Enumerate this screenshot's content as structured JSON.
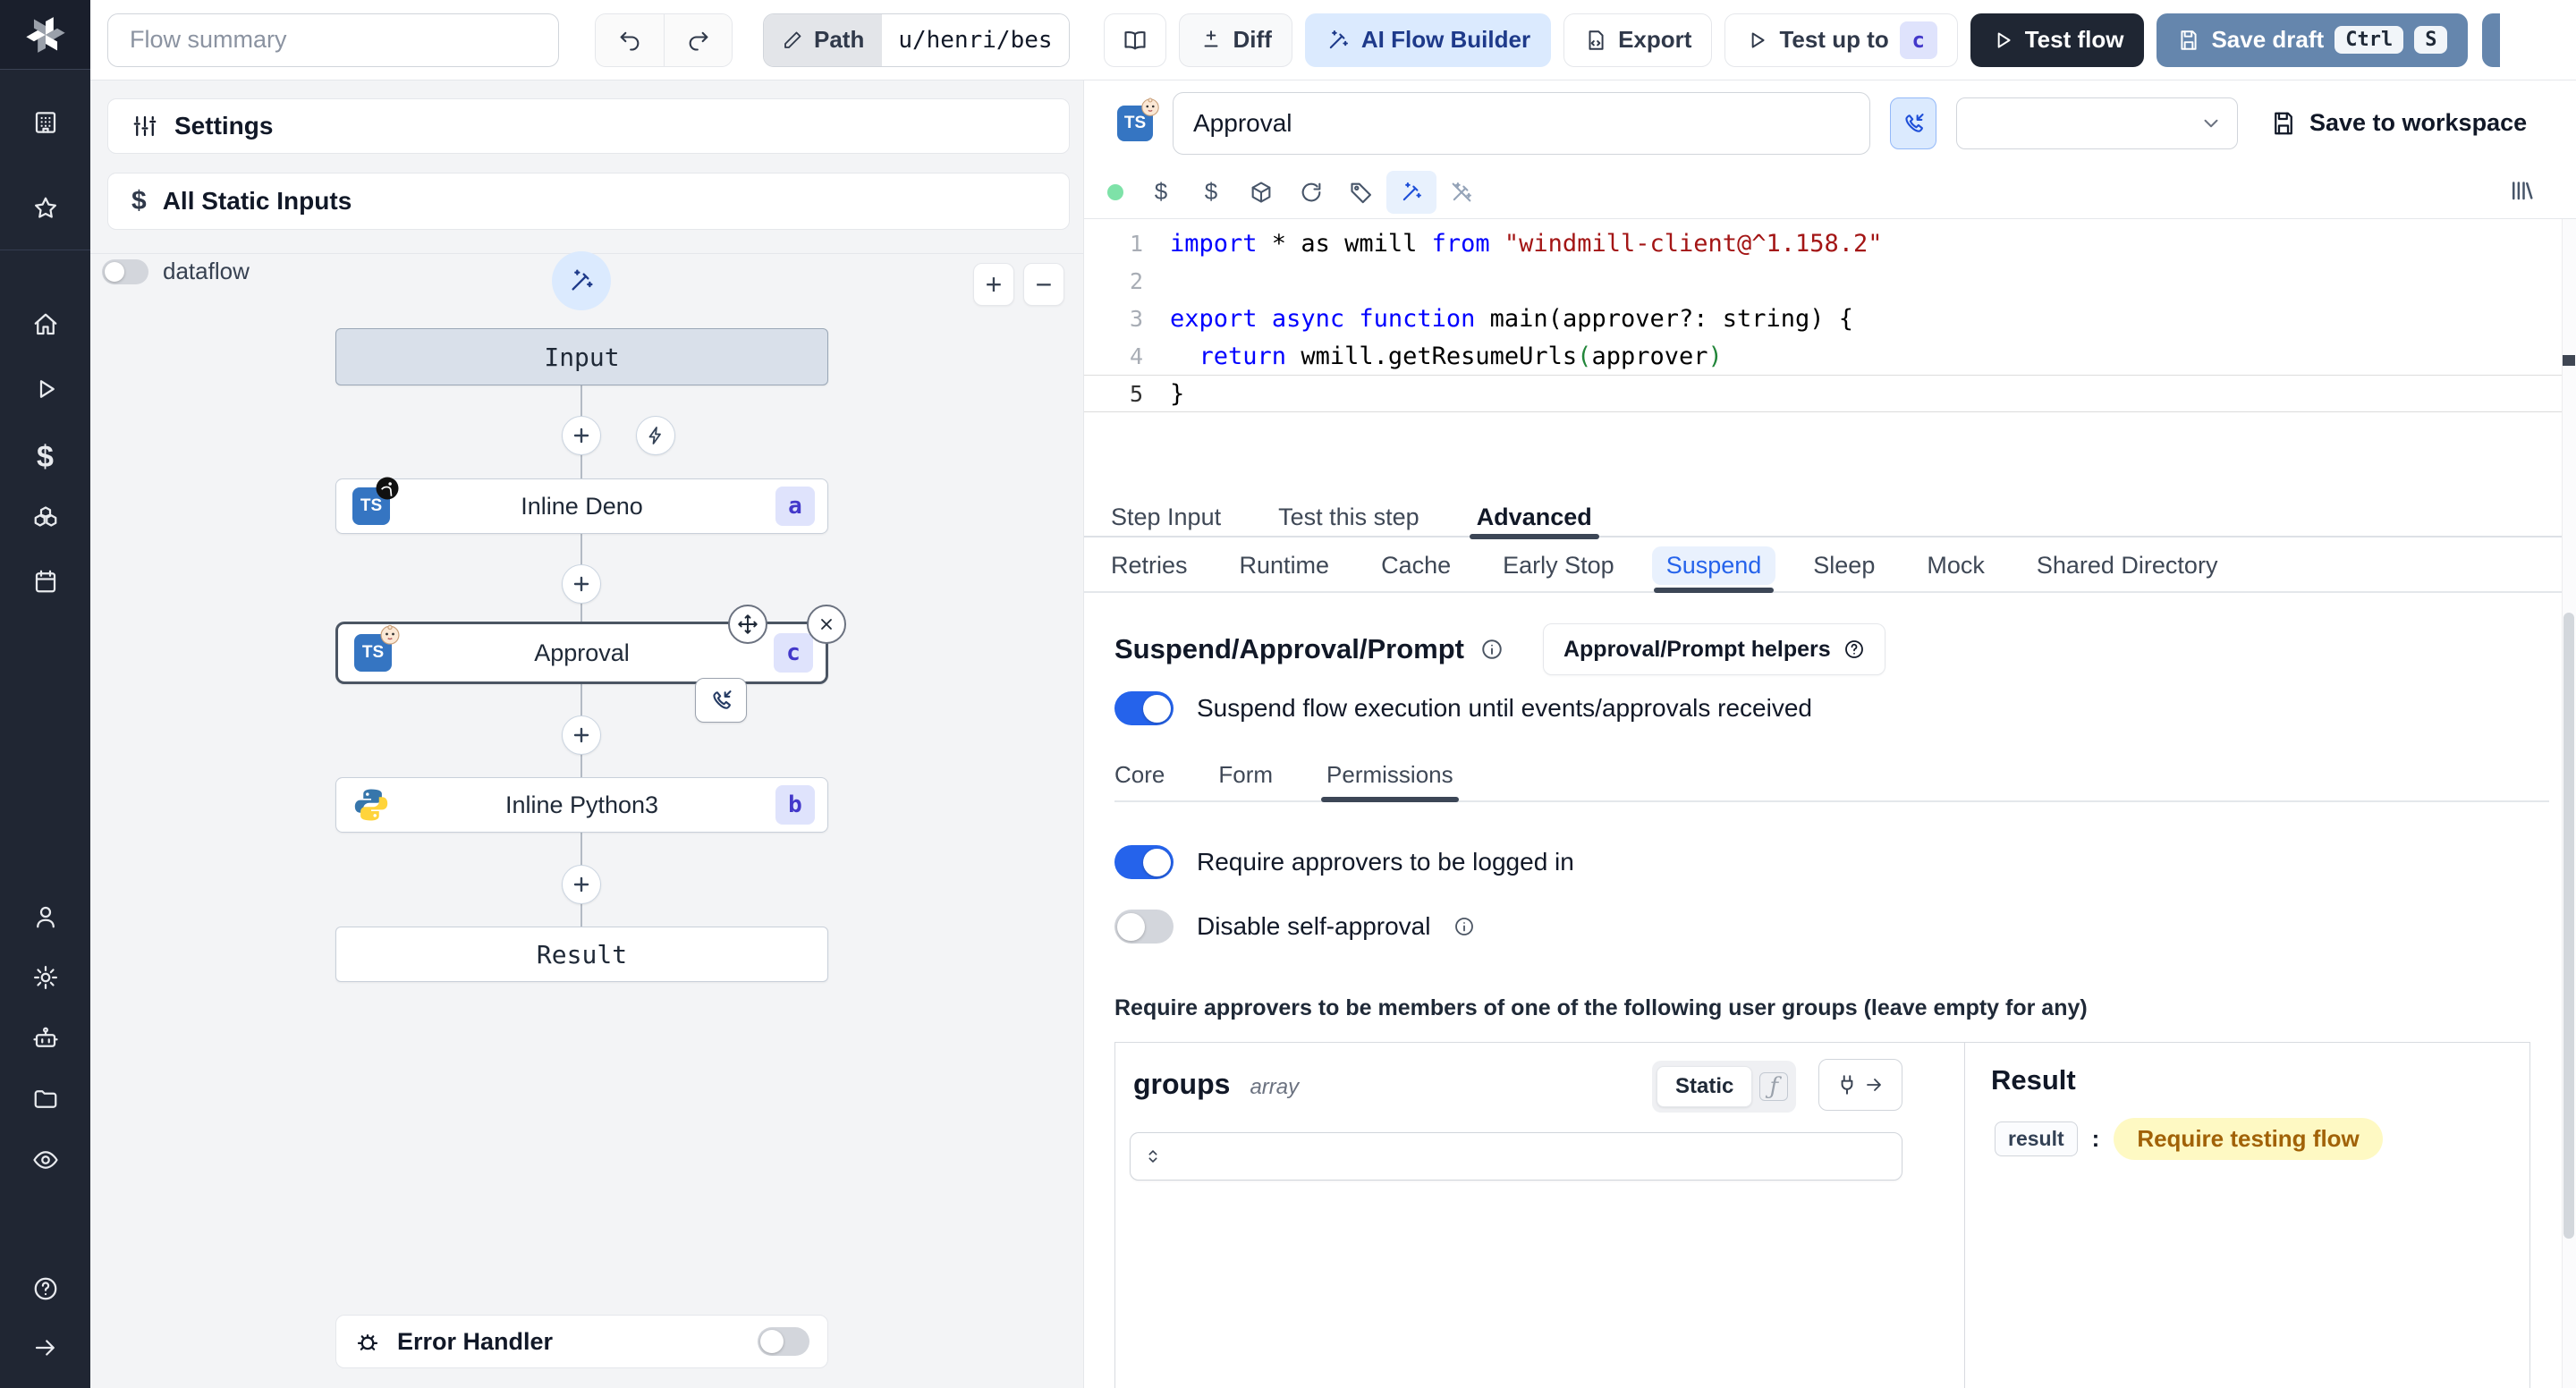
{
  "topbar": {
    "flow_summary_placeholder": "Flow summary",
    "path_label": "Path",
    "path_value": "u/henri/bes",
    "diff_label": "Diff",
    "ai_label": "AI Flow Builder",
    "export_label": "Export",
    "test_up_to_label": "Test up to",
    "test_up_to_badge": "c",
    "test_flow_label": "Test flow",
    "save_draft_label": "Save draft",
    "kbd_ctrl": "Ctrl",
    "kbd_s": "S"
  },
  "left": {
    "settings_label": "Settings",
    "static_inputs_label": "All Static Inputs",
    "dataflow_label": "dataflow",
    "zoom_in": "+",
    "zoom_out": "−",
    "error_handler_label": "Error Handler",
    "nodes": {
      "input_label": "Input",
      "deno_label": "Inline Deno",
      "deno_badge": "a",
      "approval_label": "Approval",
      "approval_badge": "c",
      "python_label": "Inline Python3",
      "python_badge": "b",
      "result_label": "Result"
    }
  },
  "right": {
    "step_name_value": "Approval",
    "save_to_workspace_label": "Save to workspace",
    "editor": {
      "current_line": 5,
      "lines": [
        [
          [
            "kw",
            "import"
          ],
          [
            "pl",
            " * as wmill "
          ],
          [
            "kw",
            "from"
          ],
          [
            "str",
            " \"windmill-client@^1.158.2\""
          ]
        ],
        [],
        [
          [
            "kw",
            "export"
          ],
          [
            "pl",
            " "
          ],
          [
            "kw",
            "async"
          ],
          [
            "pl",
            " "
          ],
          [
            "kw",
            "function"
          ],
          [
            "pl",
            " main(approver?: string) {"
          ]
        ],
        [
          [
            "pl",
            "  "
          ],
          [
            "kw",
            "return"
          ],
          [
            "pl",
            " wmill.getResumeUrls"
          ],
          [
            "grn",
            "("
          ],
          [
            "pl",
            "approver"
          ],
          [
            "grn",
            ")"
          ]
        ],
        [
          [
            "pl",
            "}"
          ]
        ]
      ]
    },
    "tabs": [
      {
        "label": "Step Input"
      },
      {
        "label": "Test this step"
      },
      {
        "label": "Advanced"
      }
    ],
    "subtabs": [
      {
        "label": "Retries"
      },
      {
        "label": "Runtime"
      },
      {
        "label": "Cache"
      },
      {
        "label": "Early Stop"
      },
      {
        "label": "Suspend"
      },
      {
        "label": "Sleep"
      },
      {
        "label": "Mock"
      },
      {
        "label": "Shared Directory"
      }
    ],
    "suspend": {
      "title": "Suspend/Approval/Prompt",
      "helpers_label": "Approval/Prompt helpers",
      "toggle_main_label": "Suspend flow execution until events/approvals received",
      "inner_tabs": [
        {
          "label": "Core"
        },
        {
          "label": "Form"
        },
        {
          "label": "Permissions"
        }
      ],
      "toggle_logged_label": "Require approvers to be logged in",
      "toggle_self_label": "Disable self-approval",
      "note": "Require approvers to be members of one of the following user groups (leave empty for any)",
      "field_name": "groups",
      "field_type": "array",
      "static_label": "Static",
      "result_title": "Result",
      "result_key": "result",
      "colon": ":",
      "result_value": "Require testing flow"
    }
  },
  "icons": {
    "dollar": "$",
    "fx": "ƒ",
    "ts": "TS"
  },
  "colors": {
    "accent": "#2563eb",
    "badge_bg": "#dfe3fc",
    "badge_text": "#4338ca",
    "amber_bg": "#fef9c3",
    "amber_text": "#a16207",
    "kw": "#0000ff",
    "str": "#a31515",
    "grn": "#22863a"
  }
}
